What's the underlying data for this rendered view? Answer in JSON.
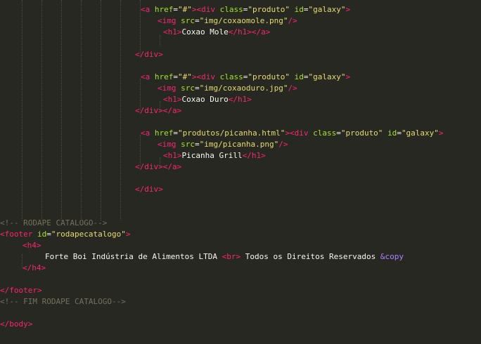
{
  "editor": {
    "colors": {
      "background": "#272822",
      "tag": "#f92672",
      "attribute": "#a6e22e",
      "string": "#e6db74",
      "comment": "#75715e",
      "text": "#f8f8f2",
      "entity": "#ae81ff"
    },
    "lines": [
      {
        "indent": 25,
        "tokens": [
          {
            "k": "tag",
            "t": "<a "
          },
          {
            "k": "attr",
            "t": "href"
          },
          {
            "k": "txt",
            "t": "="
          },
          {
            "k": "str",
            "t": "\"#\""
          },
          {
            "k": "tag",
            "t": "><div "
          },
          {
            "k": "attr",
            "t": "class"
          },
          {
            "k": "txt",
            "t": "="
          },
          {
            "k": "str",
            "t": "\"produto\""
          },
          {
            "k": "txt",
            "t": " "
          },
          {
            "k": "attr",
            "t": "id"
          },
          {
            "k": "txt",
            "t": "="
          },
          {
            "k": "str",
            "t": "\"galaxy\""
          },
          {
            "k": "tag",
            "t": ">"
          }
        ]
      },
      {
        "indent": 28,
        "tokens": [
          {
            "k": "tag",
            "t": "<img "
          },
          {
            "k": "attr",
            "t": "src"
          },
          {
            "k": "txt",
            "t": "="
          },
          {
            "k": "str",
            "t": "\"img/coxaomole.png\""
          },
          {
            "k": "tag",
            "t": "/>"
          }
        ]
      },
      {
        "indent": 29,
        "tokens": [
          {
            "k": "tag",
            "t": "<h1>"
          },
          {
            "k": "txt",
            "t": "Coxao Mole"
          },
          {
            "k": "tag",
            "t": "</h1></a>"
          }
        ]
      },
      {
        "indent": 0,
        "tokens": []
      },
      {
        "indent": 24,
        "tokens": [
          {
            "k": "tag",
            "t": "</div>"
          }
        ]
      },
      {
        "indent": 0,
        "tokens": []
      },
      {
        "indent": 25,
        "tokens": [
          {
            "k": "tag",
            "t": "<a "
          },
          {
            "k": "attr",
            "t": "href"
          },
          {
            "k": "txt",
            "t": "="
          },
          {
            "k": "str",
            "t": "\"#\""
          },
          {
            "k": "tag",
            "t": "><div "
          },
          {
            "k": "attr",
            "t": "class"
          },
          {
            "k": "txt",
            "t": "="
          },
          {
            "k": "str",
            "t": "\"produto\""
          },
          {
            "k": "txt",
            "t": " "
          },
          {
            "k": "attr",
            "t": "id"
          },
          {
            "k": "txt",
            "t": "="
          },
          {
            "k": "str",
            "t": "\"galaxy\""
          },
          {
            "k": "tag",
            "t": ">"
          }
        ]
      },
      {
        "indent": 28,
        "tokens": [
          {
            "k": "tag",
            "t": "<img "
          },
          {
            "k": "attr",
            "t": "src"
          },
          {
            "k": "txt",
            "t": "="
          },
          {
            "k": "str",
            "t": "\"img/coxaoduro.jpg\""
          },
          {
            "k": "tag",
            "t": "/>"
          }
        ]
      },
      {
        "indent": 29,
        "tokens": [
          {
            "k": "tag",
            "t": "<h1>"
          },
          {
            "k": "txt",
            "t": "Coxao Duro"
          },
          {
            "k": "tag",
            "t": "</h1>"
          }
        ]
      },
      {
        "indent": 24,
        "tokens": [
          {
            "k": "tag",
            "t": "</div></a>"
          }
        ]
      },
      {
        "indent": 0,
        "tokens": []
      },
      {
        "indent": 25,
        "tokens": [
          {
            "k": "tag",
            "t": "<a "
          },
          {
            "k": "attr",
            "t": "href"
          },
          {
            "k": "txt",
            "t": "="
          },
          {
            "k": "str",
            "t": "\"produtos/picanha.html\""
          },
          {
            "k": "tag",
            "t": "><div "
          },
          {
            "k": "attr",
            "t": "class"
          },
          {
            "k": "txt",
            "t": "="
          },
          {
            "k": "str",
            "t": "\"produto\""
          },
          {
            "k": "txt",
            "t": " "
          },
          {
            "k": "attr",
            "t": "id"
          },
          {
            "k": "txt",
            "t": "="
          },
          {
            "k": "str",
            "t": "\"galaxy\""
          },
          {
            "k": "tag",
            "t": ">"
          }
        ]
      },
      {
        "indent": 28,
        "tokens": [
          {
            "k": "tag",
            "t": "<img "
          },
          {
            "k": "attr",
            "t": "src"
          },
          {
            "k": "txt",
            "t": "="
          },
          {
            "k": "str",
            "t": "\"img/picanha.png\""
          },
          {
            "k": "tag",
            "t": "/>"
          }
        ]
      },
      {
        "indent": 29,
        "tokens": [
          {
            "k": "tag",
            "t": "<h1>"
          },
          {
            "k": "txt",
            "t": "Picanha Grill"
          },
          {
            "k": "tag",
            "t": "</h1>"
          }
        ]
      },
      {
        "indent": 24,
        "tokens": [
          {
            "k": "tag",
            "t": "</div></a>"
          }
        ]
      },
      {
        "indent": 0,
        "tokens": []
      },
      {
        "indent": 24,
        "tokens": [
          {
            "k": "tag",
            "t": "</div>"
          }
        ]
      },
      {
        "indent": 0,
        "tokens": []
      },
      {
        "indent": 0,
        "tokens": []
      },
      {
        "indent": 0,
        "tokens": [
          {
            "k": "cmt",
            "t": "<!-- RODAPE CATALOGO-->"
          }
        ]
      },
      {
        "indent": 0,
        "tokens": [
          {
            "k": "tag",
            "t": "<footer "
          },
          {
            "k": "attr",
            "t": "id"
          },
          {
            "k": "txt",
            "t": "="
          },
          {
            "k": "str",
            "t": "\"rodapecatalogo\""
          },
          {
            "k": "tag",
            "t": ">"
          }
        ]
      },
      {
        "indent": 4,
        "tokens": [
          {
            "k": "tag",
            "t": "<h4>"
          }
        ]
      },
      {
        "indent": 8,
        "tokens": [
          {
            "k": "txt",
            "t": "Forte Boi Indústria de Alimentos LTDA "
          },
          {
            "k": "tag",
            "t": "<br>"
          },
          {
            "k": "txt",
            "t": " Todos os Direitos Reservados "
          },
          {
            "k": "ent",
            "t": "&copy"
          }
        ]
      },
      {
        "indent": 4,
        "tokens": [
          {
            "k": "tag",
            "t": "</h4>"
          }
        ]
      },
      {
        "indent": 0,
        "tokens": []
      },
      {
        "indent": 0,
        "tokens": [
          {
            "k": "tag",
            "t": "</footer>"
          }
        ]
      },
      {
        "indent": 0,
        "tokens": [
          {
            "k": "cmt",
            "t": "<!-- FIM RODAPE CATALOGO-->"
          }
        ]
      },
      {
        "indent": 0,
        "tokens": []
      },
      {
        "indent": 0,
        "tokens": [
          {
            "k": "tag",
            "t": "</body>"
          }
        ]
      }
    ]
  }
}
